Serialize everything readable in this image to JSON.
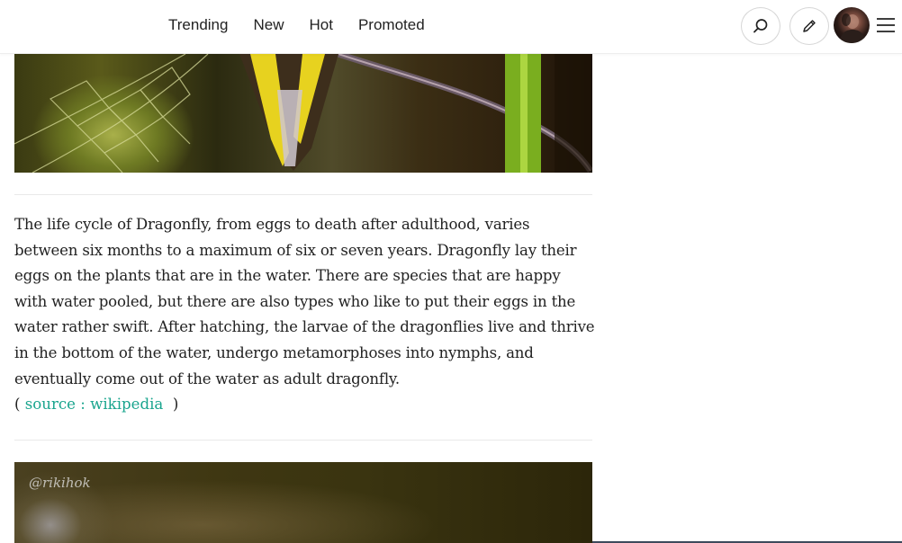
{
  "header": {
    "nav": [
      {
        "label": "Trending"
      },
      {
        "label": "New"
      },
      {
        "label": "Hot"
      },
      {
        "label": "Promoted"
      }
    ],
    "icons": {
      "search": "search-icon",
      "edit": "pencil-icon",
      "menu": "hamburger-menu-icon"
    }
  },
  "article": {
    "paragraph": "The life cycle of Dragonfly, from eggs to death after adulthood, varies between six months to a maximum of six or seven years. Dragonfly lay their eggs on the plants that are in the water. There are species that are happy with water pooled, but there are also types who like to put their eggs in the water rather swift. After hatching, the larvae of the dragonflies live and thrive in the bottom of the water, undergo metamorphoses into nymphs, and eventually come out of the water as adult dragonfly.",
    "source_open": "( ",
    "source_link": "source : wikipedia",
    "source_close": "  )",
    "photo_watermark": "@rikihok"
  },
  "colors": {
    "link": "#1aa58e",
    "text": "#222222"
  }
}
